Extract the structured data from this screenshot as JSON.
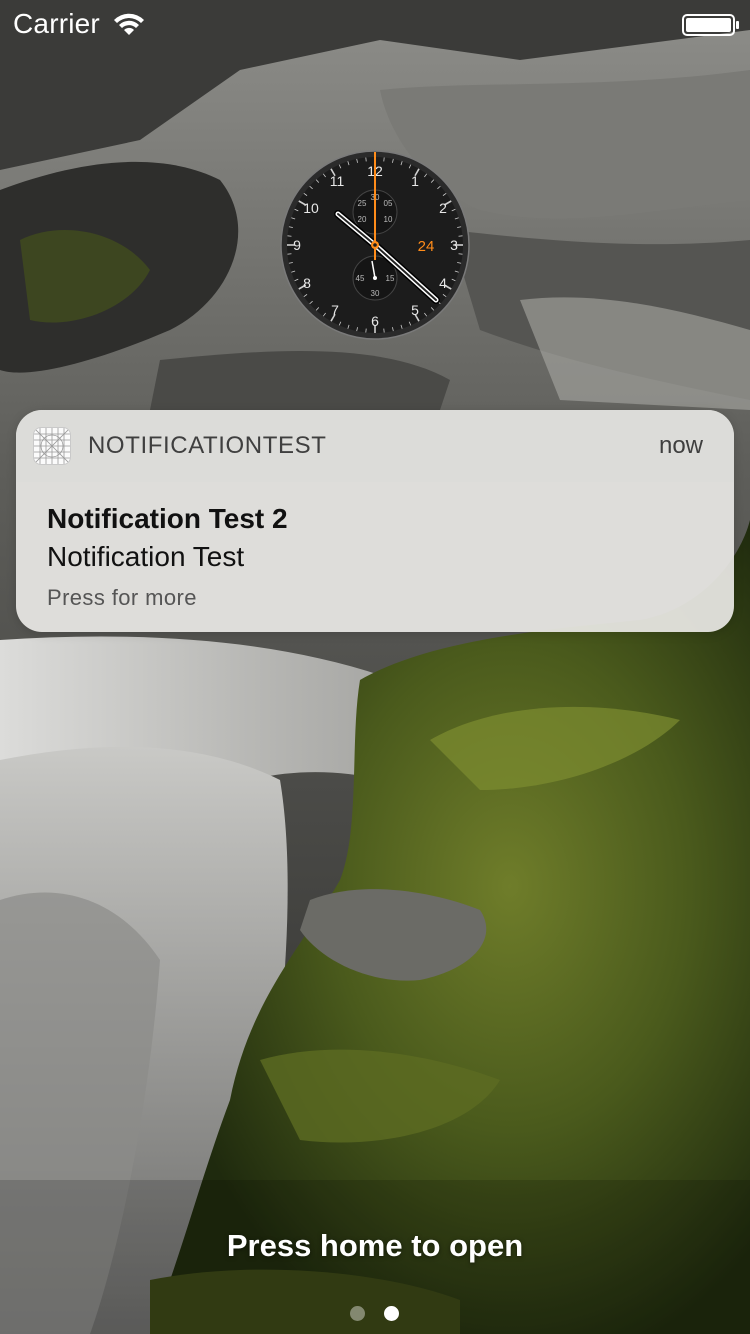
{
  "status_bar": {
    "carrier": "Carrier",
    "wifi_icon": "wifi-icon",
    "battery_icon": "battery-full-icon"
  },
  "clock_widget": {
    "hour_numerals": [
      "12",
      "1",
      "2",
      "3",
      "4",
      "5",
      "6",
      "7",
      "8",
      "9",
      "10",
      "11"
    ],
    "date": "24",
    "subdial_top_labels": [
      "25",
      "05",
      "20",
      "10"
    ],
    "subdial_top_center": "30",
    "subdial_bottom_labels": [
      "45",
      "15"
    ],
    "subdial_bottom_top": "",
    "subdial_bottom_bottom": "30",
    "accent_color": "#ff8c1a"
  },
  "notification": {
    "app_icon": "app-grid-icon",
    "app_name": "NOTIFICATIONTEST",
    "time": "now",
    "title": "Notification Test 2",
    "message": "Notification Test",
    "hint": "Press for more"
  },
  "lock_screen": {
    "home_hint": "Press home to open",
    "page_count": 2,
    "current_page": 2
  }
}
